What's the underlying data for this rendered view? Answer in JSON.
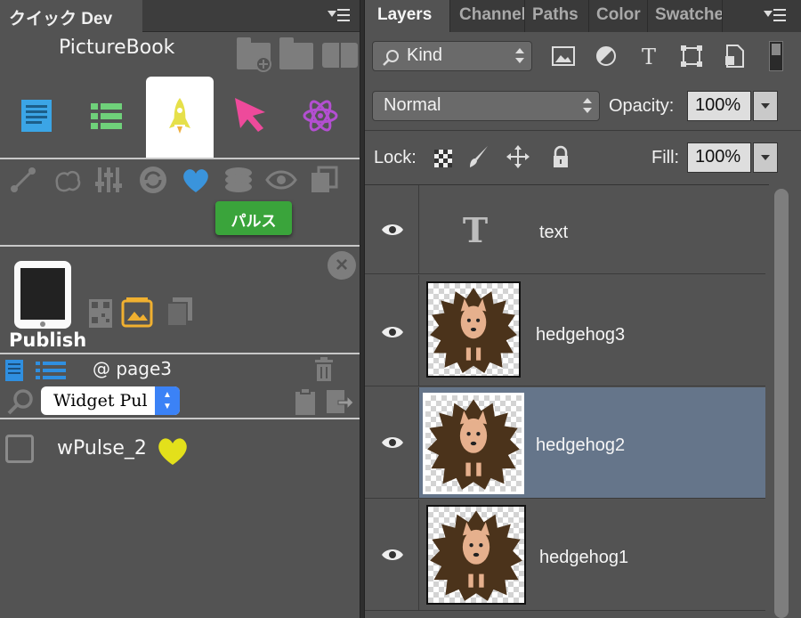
{
  "left_panel": {
    "tab_title": "クイック Dev",
    "title": "PictureBook",
    "tooltip": "パルス",
    "publish_label": "Publish",
    "page_label": "@ page3",
    "widget_search_value": "Widget Pul",
    "items": [
      {
        "label": "wPulse_2"
      }
    ]
  },
  "layers_panel": {
    "tabs": [
      "Layers",
      "Channels",
      "Paths",
      "Color",
      "Swatches"
    ],
    "filter_kind": "Kind",
    "blend_mode": "Normal",
    "opacity_label": "Opacity:",
    "opacity_value": "100%",
    "lock_label": "Lock:",
    "fill_label": "Fill:",
    "fill_value": "100%",
    "layers": [
      {
        "name": "text",
        "type": "text"
      },
      {
        "name": "hedgehog3",
        "type": "image"
      },
      {
        "name": "hedgehog2",
        "type": "image",
        "selected": true
      },
      {
        "name": "hedgehog1",
        "type": "image"
      }
    ]
  },
  "colors": {
    "panel_bg": "#535353",
    "selected_layer": "#65758a",
    "tooltip_green": "#3aa43b",
    "heart_blue": "#3a94dc",
    "heart_yellow": "#e3e01b",
    "cursor_pink": "#ee4a9b",
    "rocket_yellow": "#e6e04a",
    "atom_purple": "#b34fd1",
    "list_green": "#6fd17a",
    "doc_blue": "#3ba5e6"
  }
}
